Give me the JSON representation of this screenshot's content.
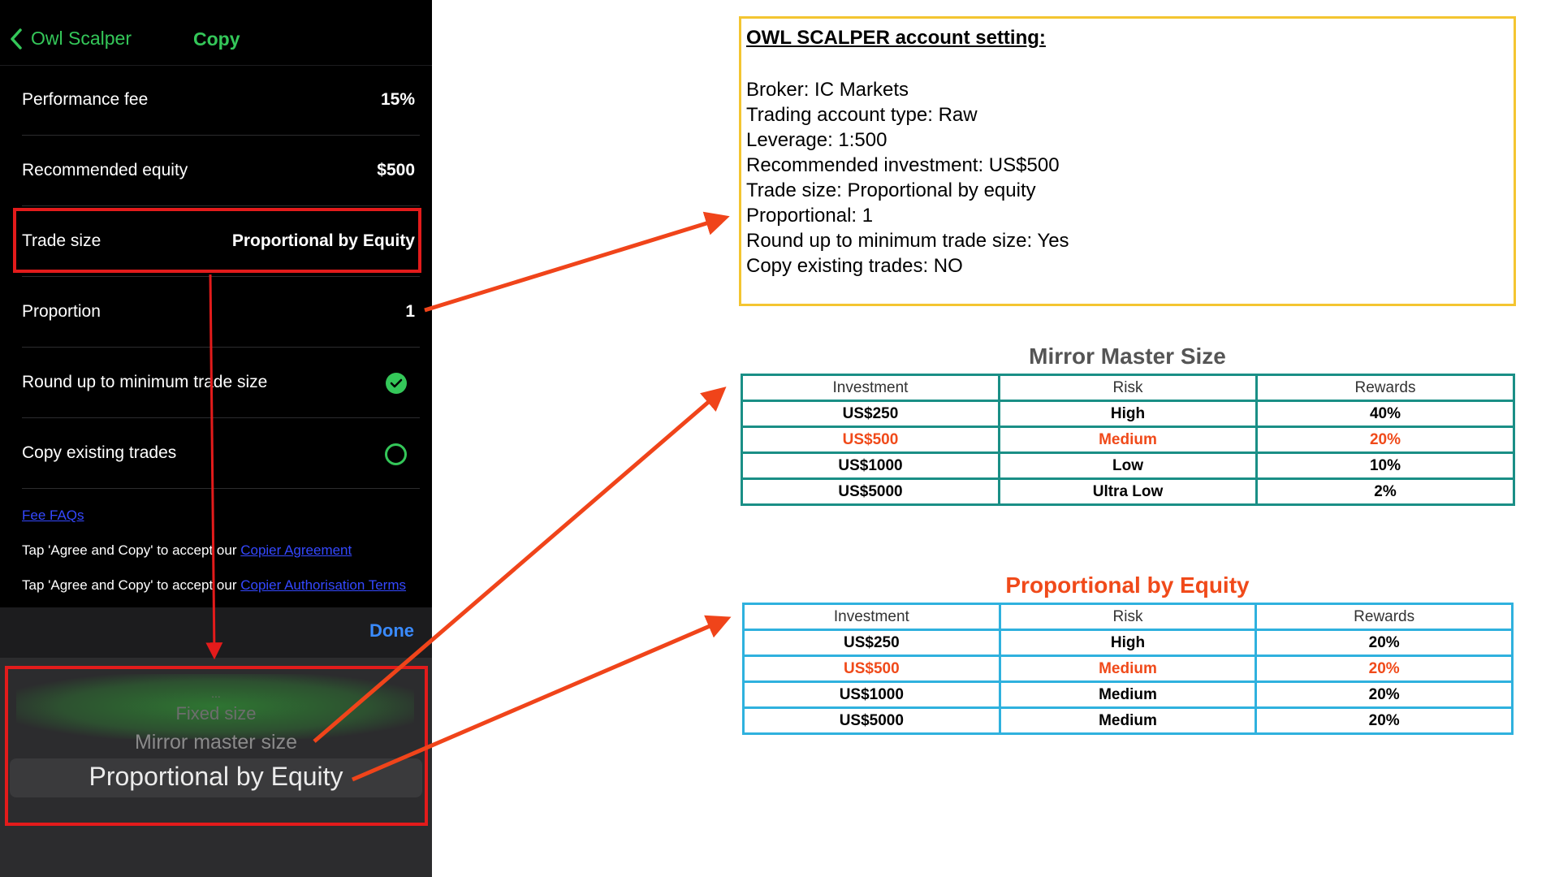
{
  "phone": {
    "nav": {
      "back_label": "Owl Scalper",
      "title": "Copy"
    },
    "rows": [
      {
        "label": "Performance fee",
        "value": "15%"
      },
      {
        "label": "Recommended equity",
        "value": "$500"
      },
      {
        "label": "Trade size",
        "value": "Proportional by Equity"
      },
      {
        "label": "Proportion",
        "value": "1"
      },
      {
        "label": "Round up to minimum trade size",
        "value": "checked"
      },
      {
        "label": "Copy existing trades",
        "value": "unchecked"
      }
    ],
    "fee_faqs": "Fee FAQs",
    "agree1": {
      "text": "Tap 'Agree and Copy' to accept our ",
      "link": "Copier Agreement"
    },
    "agree2": {
      "text": "Tap 'Agree and Copy' to accept our ",
      "link": "Copier Authorisation Terms"
    },
    "done": "Done",
    "picker": {
      "dots": "...",
      "options": [
        "Fixed size",
        "Mirror master size",
        "Proportional by Equity"
      ],
      "selected": "Proportional by Equity"
    }
  },
  "settings": {
    "title": "OWL SCALPER account setting:",
    "lines": [
      "Broker: IC Markets",
      "Trading account type: Raw",
      "Leverage: 1:500",
      "Recommended investment: US$500",
      "Trade size: Proportional by equity",
      "Proportional: 1",
      "Round up to minimum trade size: Yes",
      "Copy existing trades: NO"
    ]
  },
  "mirror_table": {
    "title": "Mirror Master Size",
    "headers": [
      "Investment",
      "Risk",
      "Rewards"
    ],
    "rows": [
      [
        "US$250",
        "High",
        "40%"
      ],
      [
        "US$500",
        "Medium",
        "20%"
      ],
      [
        "US$1000",
        "Low",
        "10%"
      ],
      [
        "US$5000",
        "Ultra Low",
        "2%"
      ]
    ]
  },
  "prop_table": {
    "title": "Proportional by Equity",
    "headers": [
      "Investment",
      "Risk",
      "Rewards"
    ],
    "rows": [
      [
        "US$250",
        "High",
        "20%"
      ],
      [
        "US$500",
        "Medium",
        "20%"
      ],
      [
        "US$1000",
        "Medium",
        "20%"
      ],
      [
        "US$5000",
        "Medium",
        "20%"
      ]
    ]
  },
  "colors": {
    "green_accent": "#34c759",
    "link_blue": "#3448ff",
    "done_blue": "#3a8bff",
    "highlight_red": "#e31b1b",
    "arrow_orange": "#f0441a",
    "settings_border": "#f4c531",
    "mirror_border": "#1a8f86",
    "prop_border": "#2fb1de",
    "prop_title": "#f04a1a",
    "mirror_title": "#555555"
  }
}
